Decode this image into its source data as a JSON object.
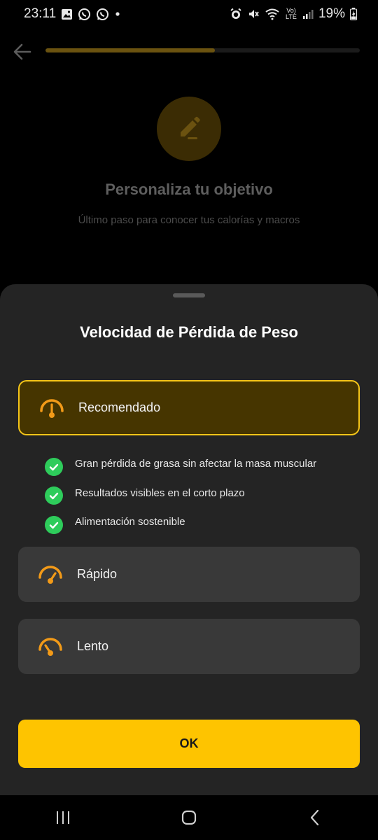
{
  "status_bar": {
    "time": "23:11",
    "battery": "19%",
    "network": "Vo) LTE"
  },
  "page": {
    "progress_fraction": 0.54,
    "title": "Personaliza tu objetivo",
    "subtitle": "Último paso para conocer tus calorías y macros",
    "hero_icon": "edit-pencil-icon"
  },
  "sheet": {
    "title": "Velocidad de Pérdida de Peso",
    "options": [
      {
        "label": "Recomendado",
        "selected": true
      },
      {
        "label": "Rápido",
        "selected": false
      },
      {
        "label": "Lento",
        "selected": false
      }
    ],
    "benefits": [
      "Gran pérdida de grasa sin afectar la masa muscular",
      "Resultados visibles en el corto plazo",
      "Alimentación sostenible"
    ],
    "ok_label": "OK"
  },
  "colors": {
    "accent": "#fec400",
    "selected_bg": "#463500",
    "check_green": "#2ecc5b",
    "sheet_bg": "#242424",
    "option_bg": "#393939"
  }
}
